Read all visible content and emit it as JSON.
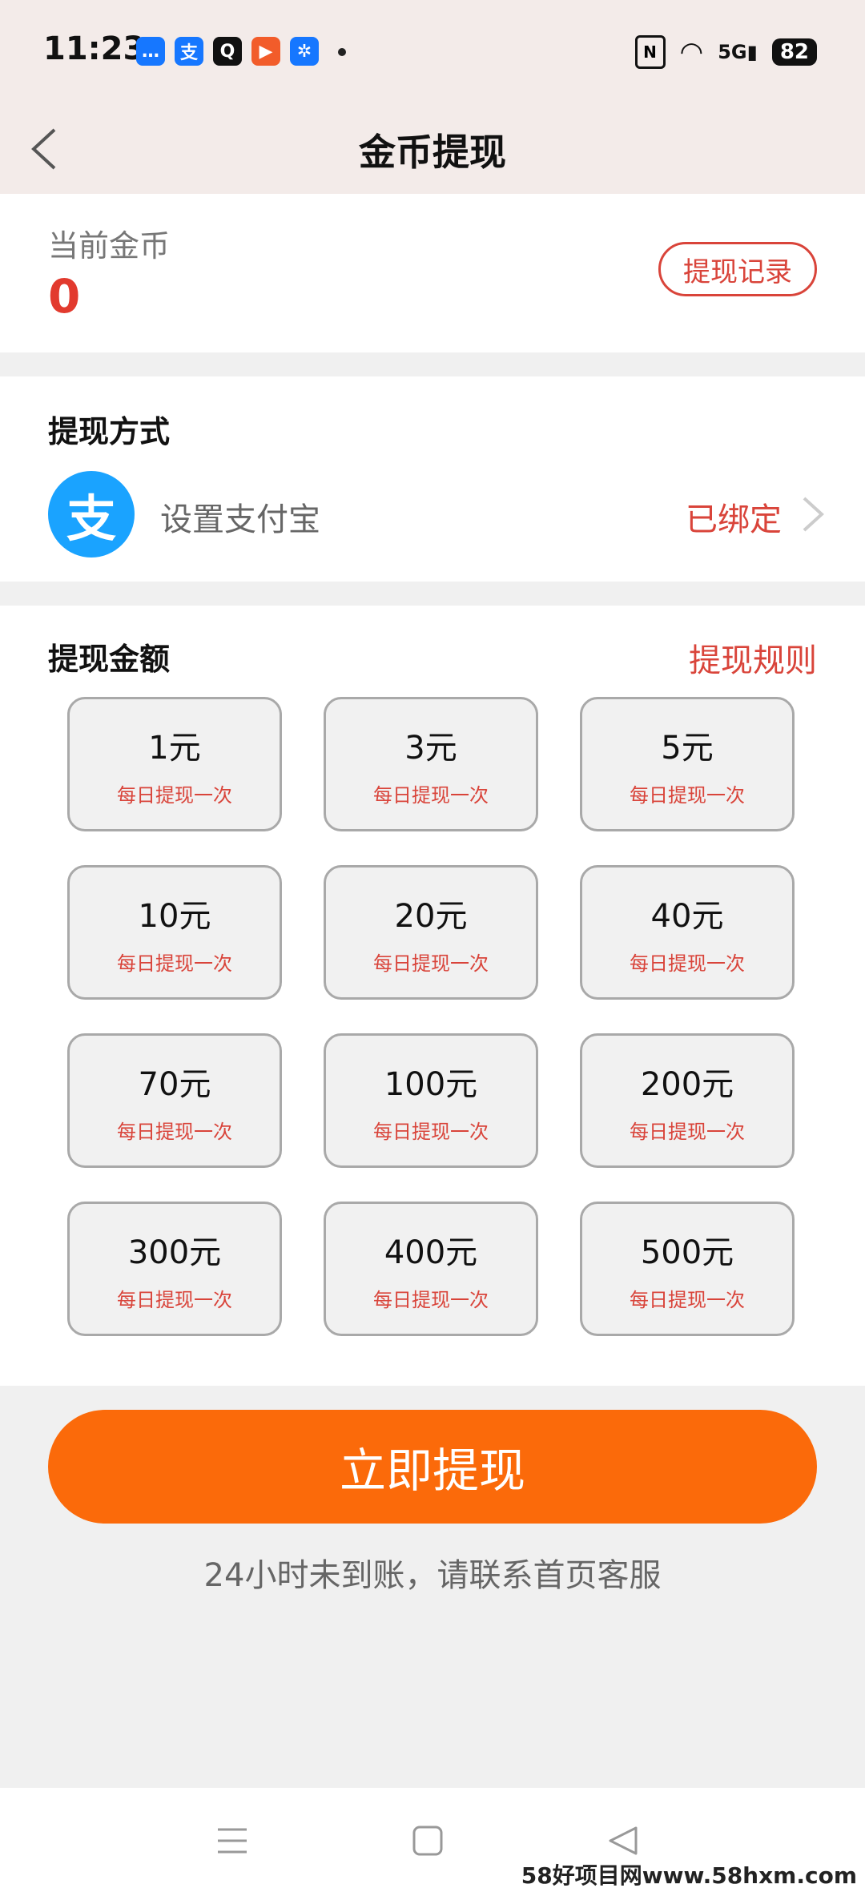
{
  "status_bar": {
    "time": "11:23",
    "network": "5G",
    "battery": "82",
    "apps": [
      {
        "icon": "message-icon",
        "color": "#1677ff",
        "glyph": "…"
      },
      {
        "icon": "alipay-icon",
        "color": "#1677ff",
        "glyph": "支"
      },
      {
        "icon": "qq-icon",
        "color": "#111111",
        "glyph": "Q"
      },
      {
        "icon": "video-app-icon",
        "color": "#f25c2a",
        "glyph": "▶"
      },
      {
        "icon": "fan-app-icon",
        "color": "#1677ff",
        "glyph": "✲"
      }
    ]
  },
  "header": {
    "title": "金币提现",
    "back_icon": "chevron-left-icon"
  },
  "coins": {
    "label": "当前金币",
    "value": "0",
    "record_button": "提现记录"
  },
  "method": {
    "title": "提现方式",
    "logo_glyph": "支",
    "pay_label": "设置支付宝",
    "status": "已绑定"
  },
  "amounts": {
    "title": "提现金额",
    "rules_link": "提现规则",
    "items": [
      {
        "value": "1元",
        "limit": "每日提现一次"
      },
      {
        "value": "3元",
        "limit": "每日提现一次"
      },
      {
        "value": "5元",
        "limit": "每日提现一次"
      },
      {
        "value": "10元",
        "limit": "每日提现一次"
      },
      {
        "value": "20元",
        "limit": "每日提现一次"
      },
      {
        "value": "40元",
        "limit": "每日提现一次"
      },
      {
        "value": "70元",
        "limit": "每日提现一次"
      },
      {
        "value": "100元",
        "limit": "每日提现一次"
      },
      {
        "value": "200元",
        "limit": "每日提现一次"
      },
      {
        "value": "300元",
        "limit": "每日提现一次"
      },
      {
        "value": "400元",
        "limit": "每日提现一次"
      },
      {
        "value": "500元",
        "limit": "每日提现一次"
      }
    ]
  },
  "action": {
    "button": "立即提现",
    "notice": "24小时未到账，请联系首页客服"
  },
  "watermark": "58好项目网www.58hxm.com",
  "colors": {
    "accent": "#fb6a0a",
    "alert_red": "#d9443a",
    "alipay_blue": "#1aa3ff"
  }
}
